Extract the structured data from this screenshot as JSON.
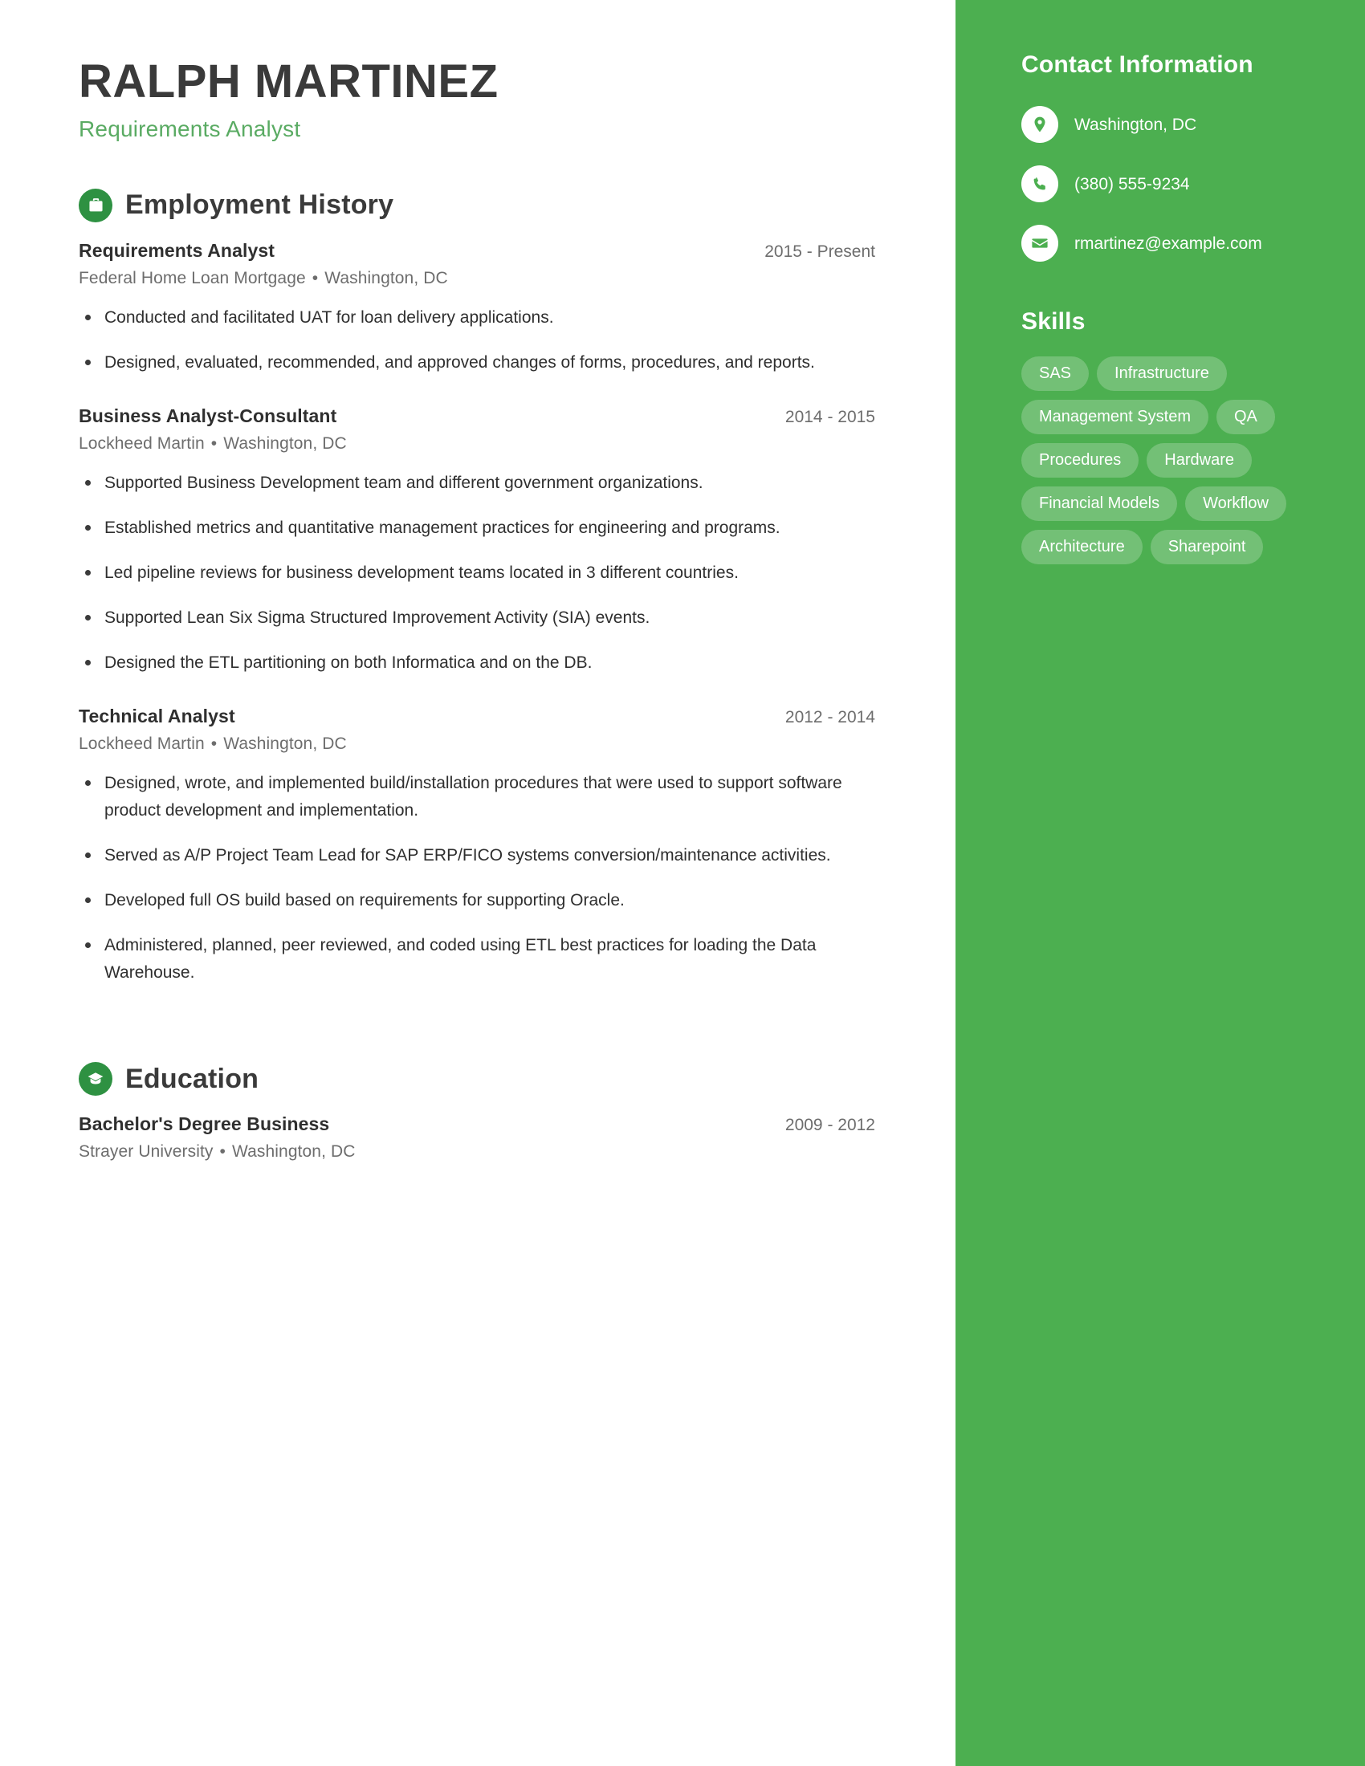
{
  "header": {
    "name": "RALPH MARTINEZ",
    "title": "Requirements Analyst"
  },
  "accent_colors": {
    "sidebar_green": "#4CAF50",
    "icon_circle_green": "#2E9142",
    "subtitle_green": "#5AAB63",
    "pill_bg": "rgba(255,255,255,0.22)"
  },
  "sections": {
    "employment": {
      "heading": "Employment History",
      "icon": "briefcase-icon",
      "entries": [
        {
          "role": "Requirements Analyst",
          "dates": "2015 - Present",
          "company": "Federal Home Loan Mortgage",
          "location": "Washington, DC",
          "bullets": [
            "Conducted and facilitated UAT for loan delivery applications.",
            "Designed, evaluated, recommended, and approved changes of forms, procedures, and reports."
          ]
        },
        {
          "role": "Business Analyst-Consultant",
          "dates": "2014 - 2015",
          "company": "Lockheed Martin",
          "location": "Washington, DC",
          "bullets": [
            "Supported Business Development team and different government organizations.",
            "Established metrics and quantitative management practices for engineering and programs.",
            "Led pipeline reviews for business development teams located in 3 different countries.",
            "Supported Lean Six Sigma Structured Improvement Activity (SIA) events.",
            "Designed the ETL partitioning on both Informatica and on the DB."
          ]
        },
        {
          "role": "Technical Analyst",
          "dates": "2012 - 2014",
          "company": "Lockheed Martin",
          "location": "Washington, DC",
          "bullets": [
            "Designed, wrote, and implemented build/installation procedures that were used to support software product development and implementation.",
            "Served as A/P Project Team Lead for SAP ERP/FICO systems conversion/maintenance activities.",
            "Developed full OS build based on requirements for supporting Oracle.",
            "Administered, planned, peer reviewed, and coded using ETL best practices for loading the Data Warehouse."
          ]
        }
      ]
    },
    "education": {
      "heading": "Education",
      "icon": "graduation-cap-icon",
      "entries": [
        {
          "degree": "Bachelor's Degree Business",
          "dates": "2009 - 2012",
          "school": "Strayer University",
          "location": "Washington, DC"
        }
      ]
    }
  },
  "sidebar": {
    "contact_heading": "Contact Information",
    "contact": [
      {
        "icon": "location-pin-icon",
        "value": "Washington, DC"
      },
      {
        "icon": "phone-icon",
        "value": "(380) 555-9234"
      },
      {
        "icon": "envelope-icon",
        "value": "rmartinez@example.com"
      }
    ],
    "skills_heading": "Skills",
    "skills": [
      "SAS",
      "Infrastructure",
      "Management System",
      "QA",
      "Procedures",
      "Hardware",
      "Financial Models",
      "Workflow",
      "Architecture",
      "Sharepoint"
    ]
  },
  "separators": {
    "meta_dot": "•"
  }
}
